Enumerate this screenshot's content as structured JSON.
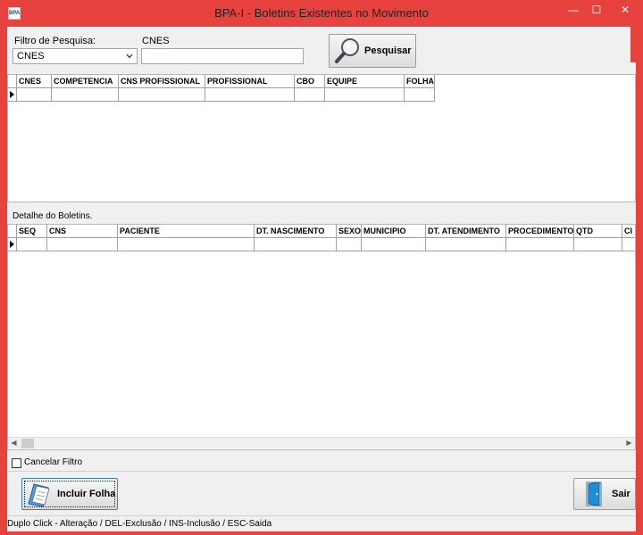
{
  "window": {
    "title": "BPA-I - Boletins Existentes no Movimento",
    "icon_text": "BPA",
    "minimize": "—",
    "maximize": "☐",
    "close": "✕"
  },
  "filter": {
    "label": "Filtro de Pesquisa:",
    "selected": "CNES",
    "field_label": "CNES",
    "value": ""
  },
  "search_button": {
    "label": "Pesquisar",
    "icon": "magnifier-icon"
  },
  "boletins_grid": {
    "columns": [
      "CNES",
      "COMPETENCIA",
      "CNS PROFISSIONAL",
      "PROFISSIONAL",
      "CBO",
      "EQUIPE",
      "FOLHA"
    ]
  },
  "detail": {
    "label": "Detalhe do Boletins.",
    "columns": [
      "SEQ",
      "CNS",
      "PACIENTE",
      "DT. NASCIMENTO",
      "SEXO",
      "MUNICIPIO",
      "DT. ATENDIMENTO",
      "PROCEDIMENTO",
      "QTD",
      "CI"
    ]
  },
  "scroll_left": "◀",
  "scroll_right": "▶",
  "cancel_filter": {
    "label": "Cancelar Filtro",
    "checked": false
  },
  "add_sheet_button": {
    "label": "Incluir Folha",
    "icon": "document-add-icon"
  },
  "exit_button": {
    "label": "Sair",
    "icon": "door-exit-icon"
  },
  "status": {
    "text": "Duplo Click - Alteração  / DEL-Exclusão / INS-Inclusão / ESC-Saida"
  },
  "colors": {
    "titlebar": "#e8423f",
    "client": "#f0f0f0"
  }
}
